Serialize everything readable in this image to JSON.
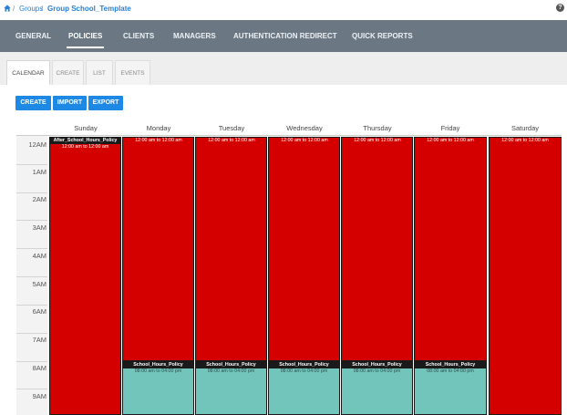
{
  "breadcrumb": {
    "groups": "Groups",
    "sep": "/",
    "current": "Group School_Template"
  },
  "help_icon": "?",
  "tabs": [
    "GENERAL",
    "POLICIES",
    "CLIENTS",
    "MANAGERS",
    "AUTHENTICATION REDIRECT",
    "QUICK REPORTS"
  ],
  "active_tab": "POLICIES",
  "subtabs": [
    "CALENDAR",
    "CREATE",
    "LIST",
    "EVENTS"
  ],
  "active_subtab": "CALENDAR",
  "buttons": {
    "create": "CREATE",
    "import": "IMPORT",
    "export": "EXPORT"
  },
  "days": [
    "Sunday",
    "Monday",
    "Tuesday",
    "Wednesday",
    "Thursday",
    "Friday",
    "Saturday"
  ],
  "hours": [
    "12AM",
    "1AM",
    "2AM",
    "3AM",
    "4AM",
    "5AM",
    "6AM",
    "7AM",
    "8AM",
    "9AM"
  ],
  "events": {
    "after_policy_name": "After_School_Hours_Policy",
    "after_time": "12:00 am to 12:00 am",
    "school_policy_name": "School_Hours_Policy",
    "school_time": "08:00 am to 04:00 pm"
  },
  "colors": {
    "after_hours": "#d40000",
    "school_hours": "#72c5bb",
    "tab_bar": "#6b7884",
    "button": "#1e88e5"
  }
}
